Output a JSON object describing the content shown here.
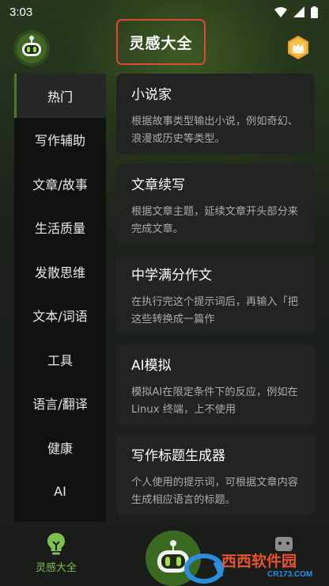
{
  "status_bar": {
    "time": "3:03"
  },
  "header": {
    "title": "灵感大全"
  },
  "sidebar": {
    "items": [
      {
        "label": "热门",
        "active": true
      },
      {
        "label": "写作辅助"
      },
      {
        "label": "文章/故事"
      },
      {
        "label": "生活质量"
      },
      {
        "label": "发散思维"
      },
      {
        "label": "文本/词语"
      },
      {
        "label": "工具"
      },
      {
        "label": "语言/翻译"
      },
      {
        "label": "健康"
      },
      {
        "label": "AI"
      }
    ]
  },
  "cards": [
    {
      "title": "小说家",
      "desc": "根据故事类型输出小说，例如奇幻、浪漫或历史等类型。"
    },
    {
      "title": "文章续写",
      "desc": "根据文章主题，延续文章开头部分来完成文章。"
    },
    {
      "title": "中学满分作文",
      "desc": "在执行完这个提示词后，再输入「把这些转换成一篇作"
    },
    {
      "title": "AI模拟",
      "desc": "模拟AI在限定条件下的反应，例如在Linux 终端，上不使用"
    },
    {
      "title": "写作标题生成器",
      "desc": "个人使用的提示词，可根据文章内容生成相应语言的标题。"
    }
  ],
  "bottom_nav": {
    "home_label": "灵感大全"
  },
  "watermark": {
    "brand": "西西软件园",
    "domain": "CR173.COM"
  },
  "colors": {
    "accent": "#7cc152",
    "highlight_border": "#e0463b"
  }
}
